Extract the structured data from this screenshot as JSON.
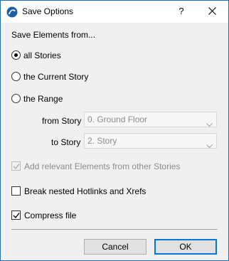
{
  "window": {
    "title": "Save Options"
  },
  "titlebar": {
    "help_label": "?"
  },
  "group": {
    "heading": "Save Elements from..."
  },
  "options": {
    "all_stories": "all Stories",
    "current_story": "the Current Story",
    "range": "the Range"
  },
  "range": {
    "from_label": "from Story",
    "from_value": "0. Ground Floor",
    "to_label": "to Story",
    "to_value": "2. Story"
  },
  "checkboxes": {
    "add_relevant": "Add relevant Elements from other Stories",
    "break_hotlinks": "Break nested Hotlinks and Xrefs",
    "compress": "Compress file"
  },
  "buttons": {
    "cancel": "Cancel",
    "ok": "OK"
  },
  "colors": {
    "accent": "#0078d7",
    "disabled_text": "#8c8c8c",
    "client_bg": "#f0f0f0"
  }
}
